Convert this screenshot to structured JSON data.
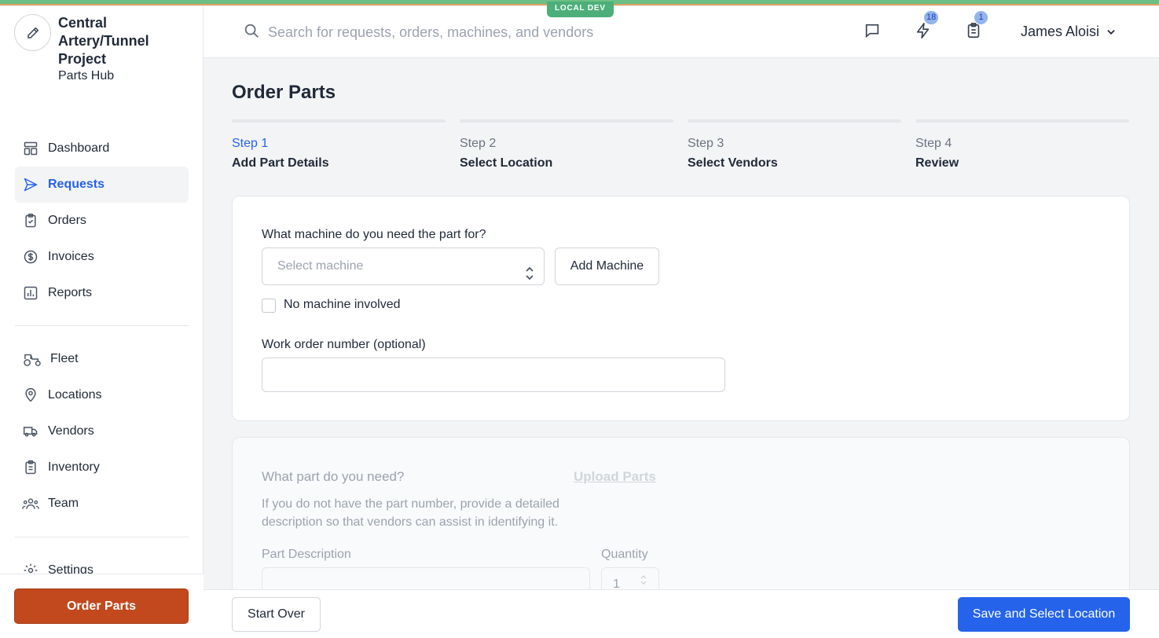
{
  "env_badge": "LOCAL DEV",
  "brand": {
    "name": "Central Artery/Tunnel Project",
    "subtitle": "Parts Hub",
    "logo_icon": "pencil-icon"
  },
  "sidebar": {
    "primary": [
      {
        "label": "Dashboard",
        "icon": "dashboard-icon",
        "active": false
      },
      {
        "label": "Requests",
        "icon": "paper-plane-icon",
        "active": true
      },
      {
        "label": "Orders",
        "icon": "clipboard-check-icon",
        "active": false
      },
      {
        "label": "Invoices",
        "icon": "dollar-circle-icon",
        "active": false
      },
      {
        "label": "Reports",
        "icon": "bar-chart-icon",
        "active": false
      }
    ],
    "secondary": [
      {
        "label": "Fleet",
        "icon": "tractor-icon"
      },
      {
        "label": "Locations",
        "icon": "map-pin-icon"
      },
      {
        "label": "Vendors",
        "icon": "truck-icon"
      },
      {
        "label": "Inventory",
        "icon": "clipboard-list-icon"
      },
      {
        "label": "Team",
        "icon": "users-icon"
      }
    ],
    "settings_label": "Settings",
    "order_parts_label": "Order Parts"
  },
  "header": {
    "search_placeholder": "Search for requests, orders, machines, and vendors",
    "notifications_count": "18",
    "tasks_count": "1",
    "user_name": "James Aloisi"
  },
  "page": {
    "title": "Order Parts",
    "steps": [
      {
        "number": "Step 1",
        "label": "Add Part Details",
        "active": true
      },
      {
        "number": "Step 2",
        "label": "Select Location",
        "active": false
      },
      {
        "number": "Step 3",
        "label": "Select Vendors",
        "active": false
      },
      {
        "number": "Step 4",
        "label": "Review",
        "active": false
      }
    ],
    "machine": {
      "question": "What machine do you need the part for?",
      "select_placeholder": "Select machine",
      "add_label": "Add Machine",
      "no_machine_label": "No machine involved",
      "work_order_label": "Work order number (optional)",
      "work_order_value": ""
    },
    "part": {
      "question": "What part do you need?",
      "upload_label": "Upload Parts",
      "help": "If you do not have the part number, provide a detailed description so that vendors can assist in identifying it.",
      "description_label": "Part Description",
      "quantity_label": "Quantity",
      "quantity_value": "1"
    }
  },
  "footer": {
    "start_over_label": "Start Over",
    "save_label": "Save and Select Location"
  },
  "colors": {
    "accent": "#2563eb",
    "order_button": "#c2491d",
    "env_badge": "#4caf7a"
  }
}
